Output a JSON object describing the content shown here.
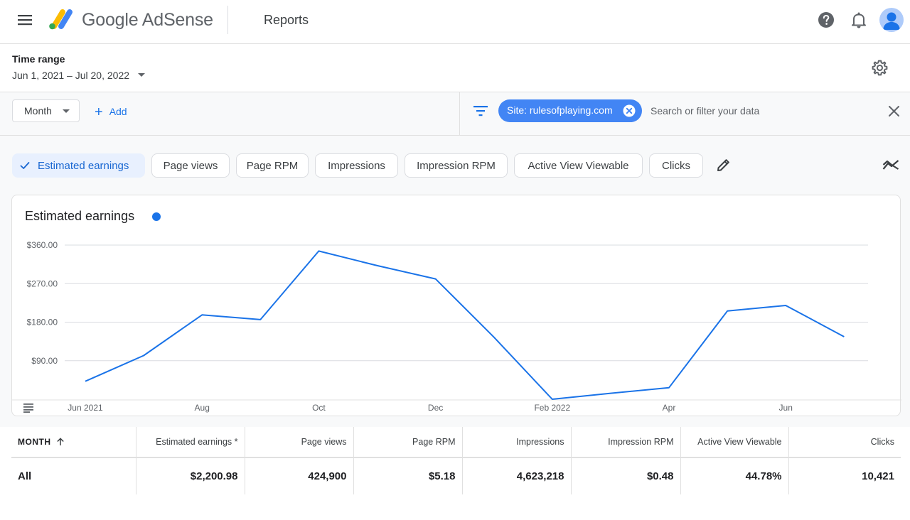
{
  "topbar": {
    "brand": "Google AdSense",
    "page_title": "Reports",
    "icons": [
      "menu-icon",
      "adsense-logo",
      "help-icon",
      "bell-icon",
      "avatar"
    ]
  },
  "time_range": {
    "label": "Time range",
    "value": "Jun 1, 2021 – Jul 20, 2022"
  },
  "filter_bar": {
    "group_by": "Month",
    "add_label": "Add",
    "site_chip": "Site: rulesofplaying.com",
    "search_placeholder": "Search or filter your data"
  },
  "metrics": {
    "chips": [
      {
        "label": "Estimated earnings",
        "selected": true
      },
      {
        "label": "Page views",
        "selected": false
      },
      {
        "label": "Page RPM",
        "selected": false
      },
      {
        "label": "Impressions",
        "selected": false
      },
      {
        "label": "Impression RPM",
        "selected": false
      },
      {
        "label": "Active View Viewable",
        "selected": false
      },
      {
        "label": "Clicks",
        "selected": false
      }
    ],
    "accent_color": "#1a73e8"
  },
  "chart": {
    "title": "Estimated earnings"
  },
  "chart_data": {
    "type": "line",
    "title": "Estimated earnings",
    "x": [
      "Jun 2021",
      "Jul 2021",
      "Aug 2021",
      "Sep 2021",
      "Oct 2021",
      "Nov 2021",
      "Dec 2021",
      "Jan 2022",
      "Feb 2022",
      "Mar 2022",
      "Apr 2022",
      "May 2022",
      "Jun 2022",
      "Jul 2022"
    ],
    "x_tick_labels": [
      "Jun 2021",
      "Aug",
      "Oct",
      "Dec",
      "Feb 2022",
      "Apr",
      "Jun"
    ],
    "x_tick_indices": [
      0,
      2,
      4,
      6,
      8,
      10,
      12
    ],
    "series": [
      {
        "values": [
          42,
          102,
          197,
          186,
          346,
          312,
          281,
          145,
          0,
          14,
          27,
          206,
          219,
          146
        ],
        "color": "#1a73e8"
      }
    ],
    "y_ticks": [
      90,
      180,
      270,
      360
    ],
    "y_tick_labels": [
      "$90.00",
      "$180.00",
      "$270.00",
      "$360.00"
    ],
    "ylim": [
      0,
      360
    ],
    "grid": true
  },
  "table": {
    "headers": [
      "MONTH",
      "Estimated earnings *",
      "Page views",
      "Page RPM",
      "Impressions",
      "Impression RPM",
      "Active View Viewable",
      "Clicks"
    ],
    "rows": [
      [
        "All",
        "$2,200.98",
        "424,900",
        "$5.18",
        "4,623,218",
        "$0.48",
        "44.78%",
        "10,421"
      ]
    ]
  }
}
